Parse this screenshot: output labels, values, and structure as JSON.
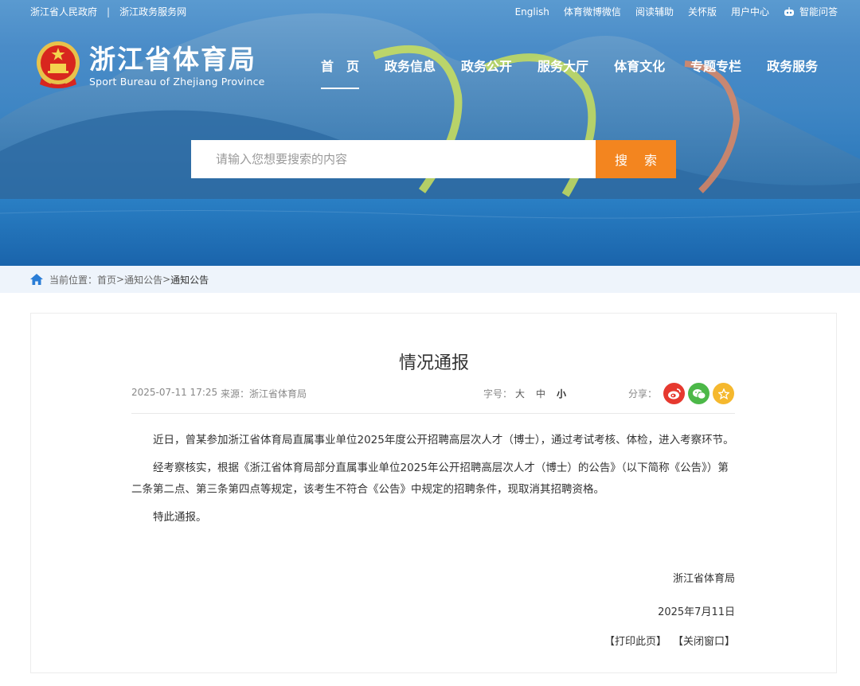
{
  "top_links": {
    "left": [
      "浙江省人民政府",
      "浙江政务服务网"
    ],
    "separator": "|",
    "right": [
      "English",
      "体育微博微信",
      "阅读辅助",
      "关怀版",
      "用户中心",
      "智能问答"
    ]
  },
  "site": {
    "title": "浙江省体育局",
    "subtitle": "Sport Bureau of Zhejiang Province"
  },
  "nav": [
    "首　页",
    "政务信息",
    "政务公开",
    "服务大厅",
    "体育文化",
    "专题专栏",
    "政务服务"
  ],
  "search": {
    "placeholder": "请输入您想要搜索的内容",
    "button": "搜 索"
  },
  "breadcrumb": {
    "prefix": "当前位置：",
    "items": [
      "首页",
      "通知公告",
      "通知公告"
    ],
    "sep": ">"
  },
  "article": {
    "title": "情况通报",
    "date": "2025-07-11 17:25",
    "source": "来源：浙江省体育局",
    "font_size_label": "字号：",
    "font_sizes": [
      "大",
      "中",
      "小"
    ],
    "share_label": "分享：",
    "paragraphs": [
      "近日，曾某参加浙江省体育局直属事业单位2025年度公开招聘高层次人才（博士），通过考试考核、体检，进入考察环节。",
      "经考察核实，根据《浙江省体育局部分直属事业单位2025年公开招聘高层次人才（博士）的公告》（以下简称《公告》）第二条第二点、第三条第四点等规定，该考生不符合《公告》中规定的招聘条件，现取消其招聘资格。",
      "特此通报。"
    ],
    "signature": "浙江省体育局",
    "sign_date": "2025年7月11日",
    "print": "【打印此页】",
    "close": "【关闭窗口】"
  },
  "colors": {
    "accent": "#f3851f",
    "breadcrumb_bg": "#eef4fb",
    "weibo": "#e6392f",
    "wechat": "#4cb848",
    "favorite": "#f5b82e"
  },
  "icons": {
    "emblem": "national-emblem-icon",
    "home": "home-icon",
    "robot": "robot-icon",
    "weibo": "weibo-icon",
    "wechat": "wechat-icon",
    "favorite": "star-icon"
  }
}
